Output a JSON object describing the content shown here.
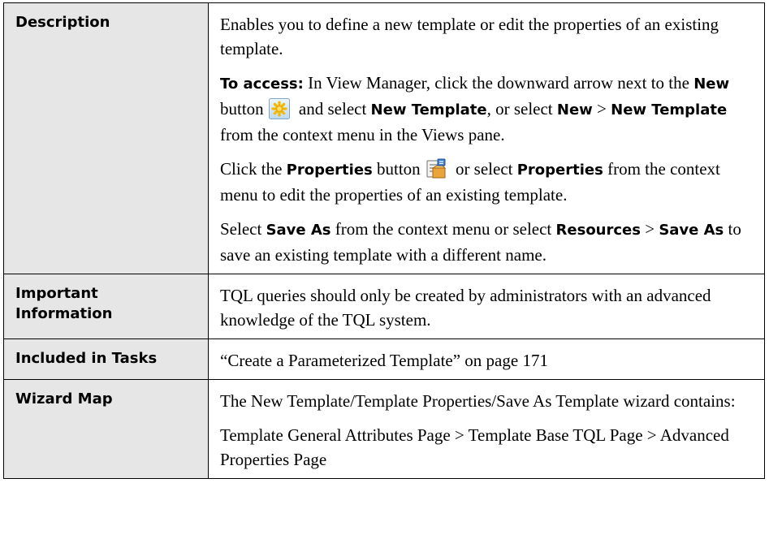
{
  "rows": {
    "description": {
      "label": "Description",
      "p1": "Enables you to define a new template or edit the properties of an existing template.",
      "p2": {
        "to_access": "To access:",
        "t1": " In View Manager, click the downward arrow next to the ",
        "new": "New",
        "t2": " button",
        "t3": " and select ",
        "new_template": "New Template",
        "t4": ", or select ",
        "new2": "New",
        "t5": " > ",
        "new_template2": "New Template",
        "t6": " from the context menu in the Views pane."
      },
      "p3": {
        "t1": "Click the ",
        "properties": "Properties",
        "t2": " button",
        "t3": " or select ",
        "properties2": "Properties",
        "t4": " from the context menu to edit the properties of an existing template."
      },
      "p4": {
        "t1": "Select ",
        "save_as": "Save As",
        "t2": " from the context menu or select ",
        "resources": "Resources",
        "t3": " > ",
        "save_as2": "Save As",
        "t4": " to save an existing template with a different name."
      }
    },
    "important": {
      "label": "Important Information",
      "text": "TQL queries should only be created by administrators with an advanced knowledge of the TQL system."
    },
    "included": {
      "label": "Included in Tasks",
      "text": "“Create a Parameterized Template” on page 171"
    },
    "wizard": {
      "label": "Wizard Map",
      "p1": "The New Template/Template Properties/Save As Template wizard contains:",
      "p2": "Template General Attributes Page > Template Base TQL Page > Advanced Properties Page"
    }
  },
  "icons": {
    "new": "new-star-icon",
    "properties": "properties-icon"
  },
  "colors": {
    "label_bg": "#e6e6e6",
    "border": "#000000",
    "new_icon_star": "#f5b800",
    "properties_icon_folder": "#e9a53a"
  }
}
